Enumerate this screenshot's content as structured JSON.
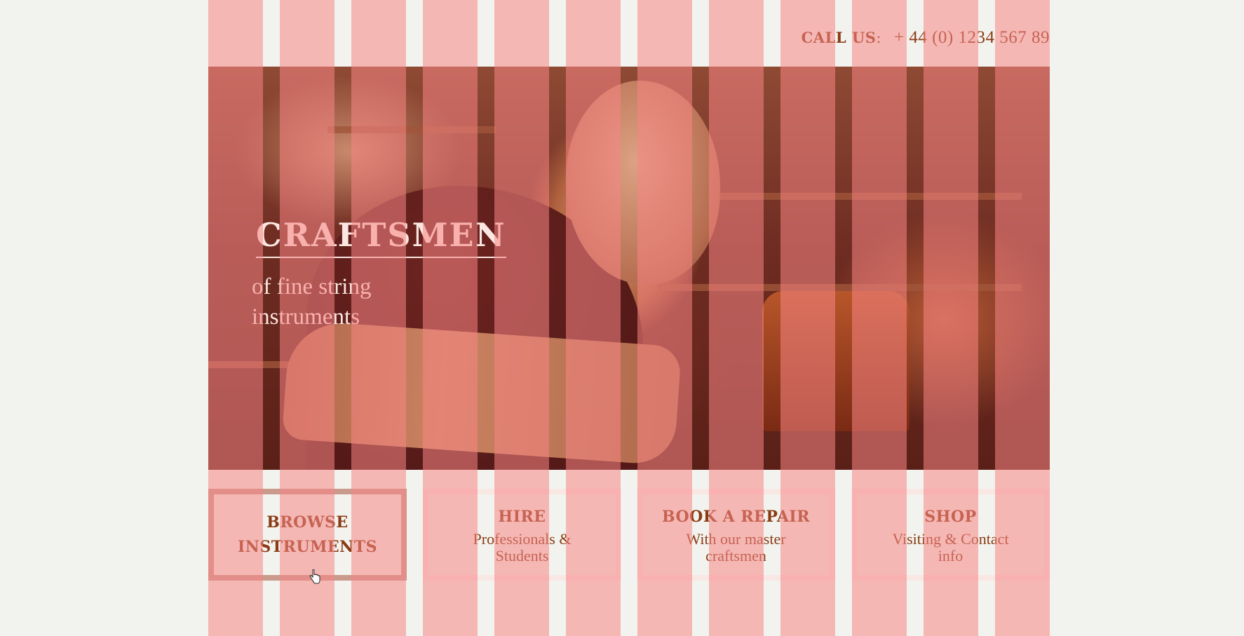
{
  "header": {
    "call_label": "CALL US",
    "call_separator": ":",
    "phone": "+ 44 (0) 1234 567 89"
  },
  "hero": {
    "title": "CRAFTSMEN",
    "subtitle": "of fine string instruments",
    "image_alt": "craftsman-working-on-violin"
  },
  "nav": {
    "tiles": [
      {
        "title": "BROWSE INSTRUMENTS",
        "subtitle": ""
      },
      {
        "title": "HIRE",
        "subtitle": "Professionals & Students"
      },
      {
        "title": "BOOK A REPAIR",
        "subtitle": "With our master craftsmen"
      },
      {
        "title": "SHOP",
        "subtitle": "Visiting & Contact info"
      }
    ]
  },
  "colors": {
    "background": "#f2f3ee",
    "accent_text": "#8a3a14",
    "stripe_overlay": "#f78585",
    "hero_text": "#fbe7e1"
  },
  "icons": {
    "cursor": "hand-pointer-icon"
  }
}
